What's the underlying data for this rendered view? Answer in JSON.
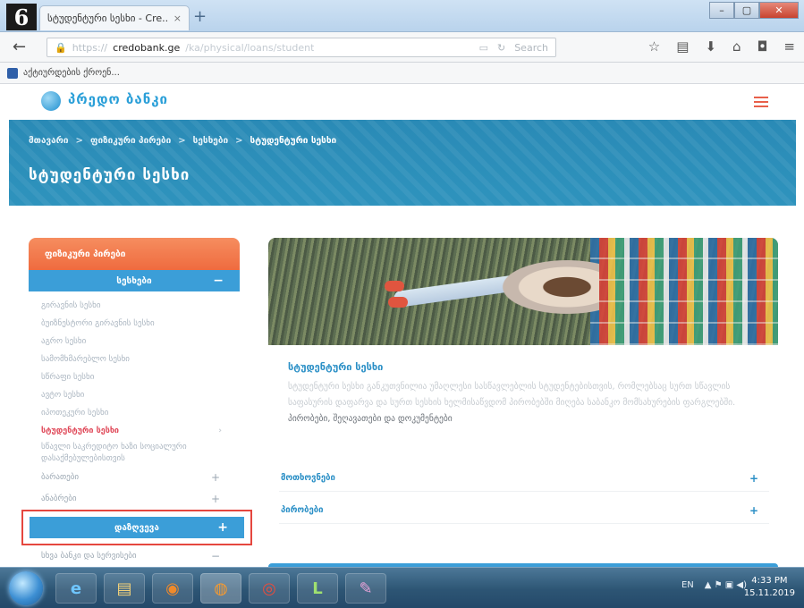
{
  "step_badge": "6",
  "browser": {
    "tab_title": "სტუდენტური სესხი - Cre...",
    "tab_close": "×",
    "new_tab": "+",
    "url_proto": "https://",
    "url_domain": "credobank.ge",
    "url_path": "/ka/physical/loans/student",
    "url_search_placeholder": "Search",
    "bookmark_label": "აქტიურდების ქროენ..."
  },
  "site": {
    "logo_text": "პრედო ბანკი",
    "breadcrumb": [
      "მთავარი",
      "ფიზიკური პირები",
      "სესხები",
      "სტუდენტური სესხი"
    ],
    "breadcrumb_separator": ">",
    "hero_title": "სტუდენტური სესხი"
  },
  "sidebar": {
    "header": "ფიზიკური პირები",
    "sub_header": "სესხები",
    "sub_sign": "−",
    "items": [
      {
        "label": "გირავნის სესხი"
      },
      {
        "label": "ბუიზნესტორი გირავნის სესხი"
      },
      {
        "label": "აგრო სესხი"
      },
      {
        "label": "სამომხმარებლო სესხი"
      },
      {
        "label": "სწრაფი სესხი"
      },
      {
        "label": "ავტო სესხი"
      },
      {
        "label": "იპოთეკური სესხი"
      },
      {
        "label": "სტუდენტური სესხი",
        "arrow": "›"
      },
      {
        "label": "სწავლი საკრედიტო ხაზი სოციალური დასაქმებულებისთვის"
      }
    ],
    "groups": [
      {
        "label": "ბარათები",
        "sign": "+"
      },
      {
        "label": "ანაბრები",
        "sign": "+"
      }
    ],
    "loans_button": "დაზღვევა",
    "loans_sign": "+",
    "last_group": {
      "label": "სხვა ბანკი და სერვისები",
      "sign": "−"
    }
  },
  "content": {
    "title": "სტუდენტური სესხი",
    "paragraph_light": "სტუდენტური სესხი განკუთვნილია უმაღლესი სასწავლებლის სტუდენტებისთვის, რომლებსაც სურთ სწავლის საფასურის დაფარვა და სურთ სესხის ხელმისაწვდომ პირობებში მიღება საბანკო მომსახურების ფარგლებში.",
    "paragraph_dark": "პირობები, შეღავათები და დოკუმენტები",
    "accordion": [
      {
        "label": "მოთხოვნები",
        "sign": "+"
      },
      {
        "label": "პირობები",
        "sign": "+"
      }
    ]
  },
  "taskbar": {
    "apps": [
      "e",
      "▤",
      "◉",
      "◍",
      "◎",
      "L",
      "✎"
    ],
    "lang": "EN",
    "tray_icons": "▲  ⚑  ▣  ◀)",
    "time": "4:33 PM",
    "date": "15.11.2019"
  },
  "colors": {
    "accent_blue": "#3b9ed8",
    "accent_orange": "#ef6b3f",
    "highlight_red": "#e5473f",
    "active_item": "#e04a5a"
  }
}
